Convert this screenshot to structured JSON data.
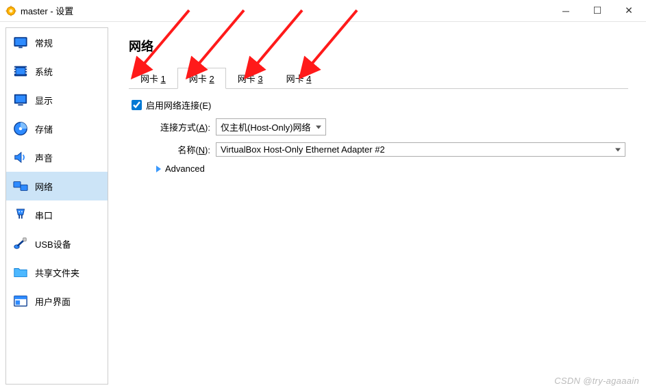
{
  "window": {
    "title": "master - 设置"
  },
  "sidebar": {
    "items": [
      {
        "label": "常规"
      },
      {
        "label": "系统"
      },
      {
        "label": "显示"
      },
      {
        "label": "存储"
      },
      {
        "label": "声音"
      },
      {
        "label": "网络"
      },
      {
        "label": "串口"
      },
      {
        "label": "USB设备"
      },
      {
        "label": "共享文件夹"
      },
      {
        "label": "用户界面"
      }
    ]
  },
  "page": {
    "title": "网络",
    "tabs": {
      "prefix": "网卡 ",
      "ids": [
        "1",
        "2",
        "3",
        "4"
      ]
    },
    "enable_label": "启用网络连接(E)",
    "enable_checked": true,
    "attach": {
      "label_pre": "连接方式(",
      "label_hot": "A",
      "label_post": "):",
      "value": "仅主机(Host-Only)网络"
    },
    "name": {
      "label_pre": "名称(",
      "label_hot": "N",
      "label_post": "):",
      "value": "VirtualBox Host-Only Ethernet Adapter #2"
    },
    "advanced_label": "Advanced"
  },
  "watermark": "CSDN @try-agaaain"
}
